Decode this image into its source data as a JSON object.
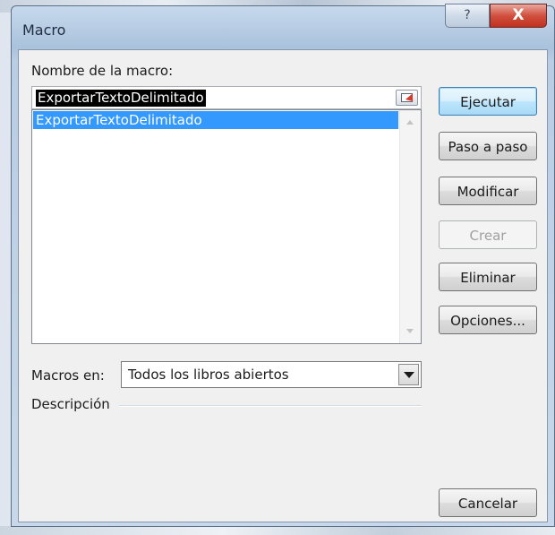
{
  "window": {
    "title": "Macro",
    "help_label": "?",
    "close_label": "X"
  },
  "macro_name": {
    "label": "Nombre de la macro:",
    "value": "ExportarTextoDelimitado"
  },
  "macro_list": {
    "items": [
      "ExportarTextoDelimitado"
    ],
    "selected_index": 0
  },
  "buttons": {
    "run": "Ejecutar",
    "step": "Paso a paso",
    "edit": "Modificar",
    "create": "Crear",
    "delete": "Eliminar",
    "options": "Opciones...",
    "cancel": "Cancelar"
  },
  "macros_in": {
    "label": "Macros en:",
    "value": "Todos los libros abiertos"
  },
  "description": {
    "label": "Descripción"
  },
  "colors": {
    "selection": "#3399ff",
    "close_button": "#c1301e",
    "title_bar": "#b8cde4"
  }
}
